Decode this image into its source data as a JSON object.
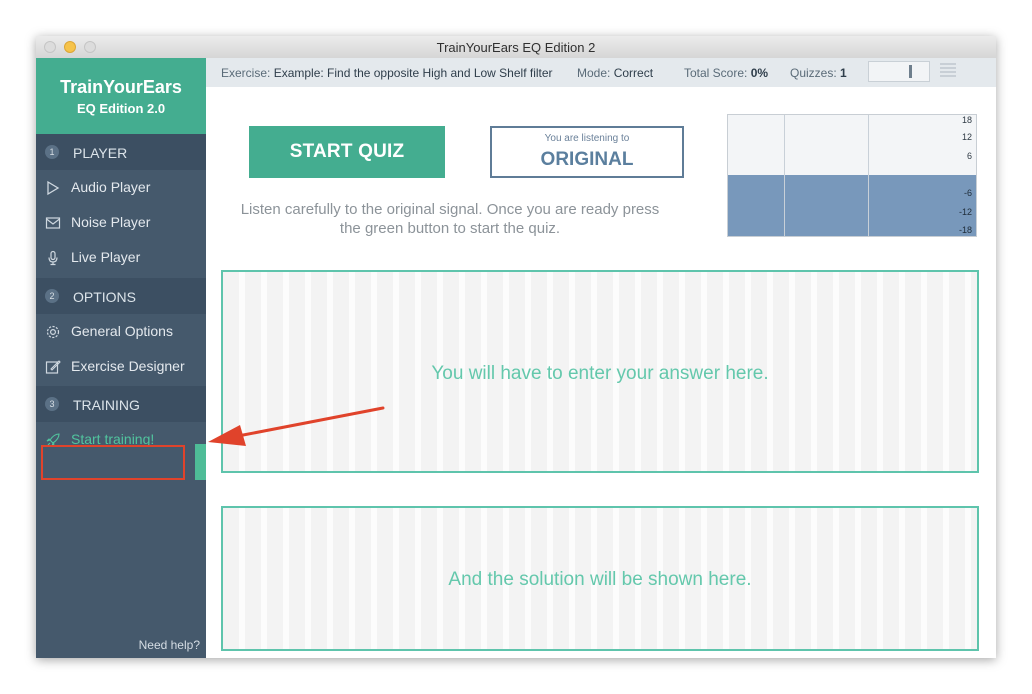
{
  "window": {
    "title": "TrainYourEars EQ Edition 2"
  },
  "sidebar": {
    "brand_name": "TrainYourEars",
    "brand_edition": "EQ Edition 2.0",
    "sections": [
      {
        "num": "1",
        "label": "PLAYER",
        "items": [
          {
            "label": "Audio Player",
            "icon": "play-icon"
          },
          {
            "label": "Noise Player",
            "icon": "noise-icon"
          },
          {
            "label": "Live Player",
            "icon": "microphone-icon"
          }
        ]
      },
      {
        "num": "2",
        "label": "OPTIONS",
        "items": [
          {
            "label": "General Options",
            "icon": "gear-icon"
          },
          {
            "label": "Exercise Designer",
            "icon": "edit-icon"
          }
        ]
      },
      {
        "num": "3",
        "label": "TRAINING",
        "items": [
          {
            "label": "Start training!",
            "icon": "rocket-icon",
            "active": true
          }
        ]
      }
    ],
    "help": "Need help?"
  },
  "status": {
    "exercise_label": "Exercise:",
    "exercise_value": "Example: Find the opposite High and Low Shelf filter",
    "mode_label": "Mode:",
    "mode_value": "Correct",
    "score_label": "Total Score:",
    "score_value": "0%",
    "quizzes_label": "Quizzes:",
    "quizzes_value": "1",
    "volume_level": 0.7
  },
  "main": {
    "start_button": "START QUIZ",
    "listening_caption": "You are listening to",
    "listening_value": "ORIGINAL",
    "instructions": "Listen carefully to the original signal. Once you are ready press the green button to start the quiz.",
    "meter_ticks": [
      "18",
      "12",
      "6",
      "-6",
      "-12",
      "-18"
    ],
    "answer_placeholder": "You will have to enter your answer here.",
    "solution_placeholder": "And the solution will be shown here."
  },
  "colors": {
    "accent": "#44ad90",
    "sidebar": "#45596c",
    "annotation": "#e0432b"
  }
}
